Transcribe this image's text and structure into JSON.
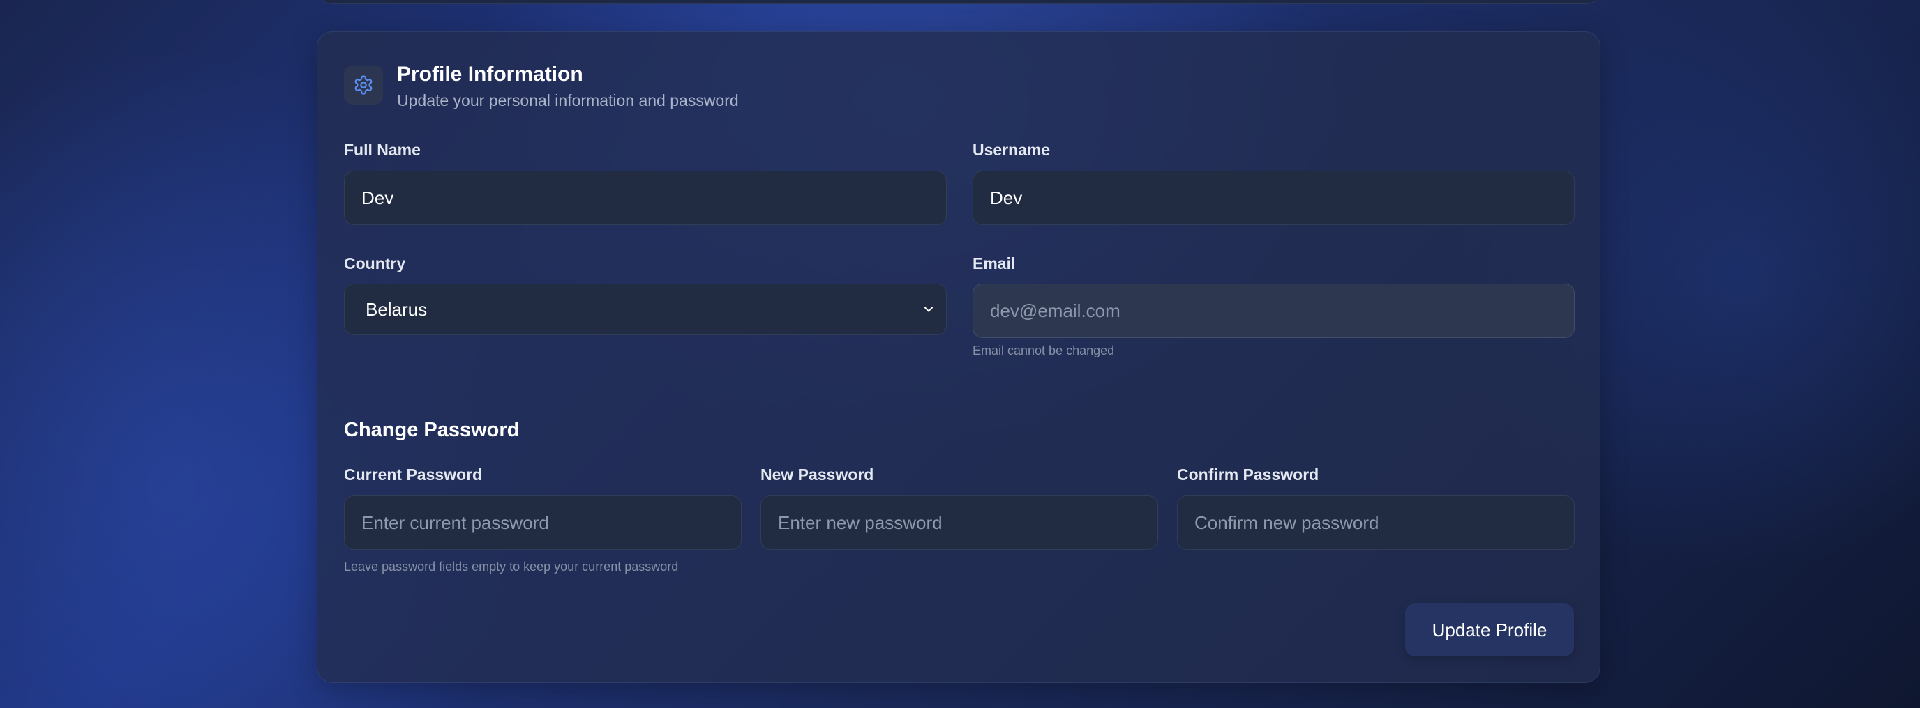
{
  "header": {
    "icon": "gear-icon",
    "title": "Profile Information",
    "subtitle": "Update your personal information and password"
  },
  "profile": {
    "full_name": {
      "label": "Full Name",
      "value": "Dev"
    },
    "username": {
      "label": "Username",
      "value": "Dev"
    },
    "country": {
      "label": "Country",
      "value": "Belarus"
    },
    "email": {
      "label": "Email",
      "placeholder": "dev@email.com",
      "hint": "Email cannot be changed"
    }
  },
  "password": {
    "section_title": "Change Password",
    "current": {
      "label": "Current Password",
      "placeholder": "Enter current password"
    },
    "new": {
      "label": "New Password",
      "placeholder": "Enter new password"
    },
    "confirm": {
      "label": "Confirm Password",
      "placeholder": "Confirm new password"
    },
    "hint": "Leave password fields empty to keep your current password"
  },
  "actions": {
    "update_label": "Update Profile"
  },
  "colors": {
    "accent_icon": "#5b8def",
    "button_bg": "#253463",
    "card_bg": "#222d50"
  }
}
